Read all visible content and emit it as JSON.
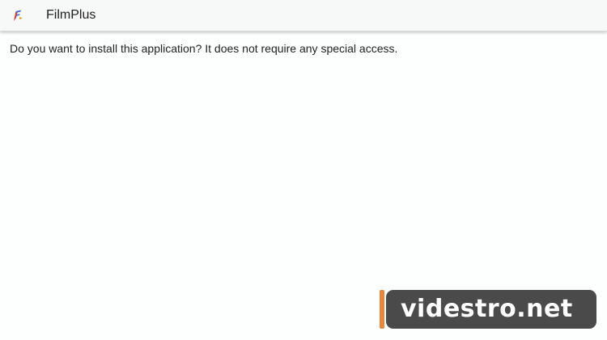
{
  "appbar": {
    "title": "FilmPlus",
    "icon": "filmplus-app-icon"
  },
  "message": {
    "text": "Do you want to install this application? It does not require any special access."
  },
  "watermark": {
    "text": "videstro.net",
    "accent_color": "#e8873b",
    "box_color": "#4a4a4a"
  }
}
